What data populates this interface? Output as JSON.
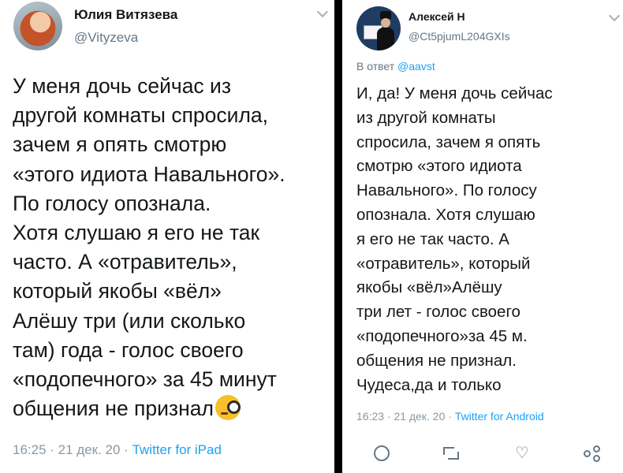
{
  "tweet_left": {
    "name": "Юлия Витязева",
    "handle": "@Vityzeva",
    "lines": [
      "У меня дочь сейчас из",
      "другой комнаты спросила,",
      "зачем я опять смотрю",
      "«этого идиота Навального».",
      "По голосу опознала.",
      "Хотя слушаю я его не так",
      "часто. А «отравитель»,",
      "который якобы «вёл»",
      "Алёшу три (или сколько",
      "там) года - голос своего",
      "«подопечного» за 45 минут",
      "общения не признал"
    ],
    "emoji": "monocle-face",
    "meta_time": "16:25 · 21 дек. 20 · ",
    "meta_source": "Twitter for iPad"
  },
  "tweet_right": {
    "name": "Алексей Н",
    "handle": "@Ct5pjumL204GXIs",
    "reply_prefix": "В ответ ",
    "reply_mention": "@aavst",
    "lines": [
      "И, да! У меня дочь сейчас",
      "из другой комнаты",
      "спросила, зачем я опять",
      "смотрю «этого идиота",
      "Навального». По голосу",
      "опознала. Хотя слушаю",
      "я его не так часто. А",
      "«отравитель», который",
      "якобы «вёл»Алёшу",
      "три  лет - голос своего",
      "«подопечного»за 45 м.",
      "общения не признал.",
      "Чудеса,да и только"
    ],
    "meta_time": "16:23 · 21 дек. 20 · ",
    "meta_source": "Twitter for Android",
    "actions": [
      "reply-icon",
      "retweet-icon",
      "like-icon",
      "share-icon"
    ]
  },
  "colors": {
    "text": "#14171a",
    "secondary": "#657786",
    "link": "#1da1f2",
    "background": "#000000"
  }
}
